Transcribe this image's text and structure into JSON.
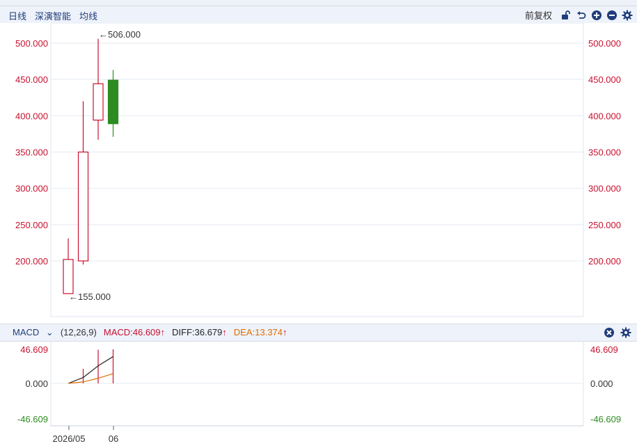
{
  "toolbar": {
    "tabs": [
      "日线",
      "深演智能",
      "均线"
    ],
    "adjust_label": "前复权"
  },
  "price_axis": {
    "ticks": [
      "500.000",
      "450.000",
      "400.000",
      "350.000",
      "300.000",
      "250.000",
      "200.000"
    ],
    "tick_values": [
      500,
      450,
      400,
      350,
      300,
      250,
      200
    ],
    "color": "#c8102e"
  },
  "annotations": {
    "high": "←506.000",
    "low": "←155.000"
  },
  "macd": {
    "name": "MACD",
    "params": "(12,26,9)",
    "macd_label": "MACD:46.609",
    "diff_label": "DIFF:36.679",
    "dea_label": "DEA:13.374",
    "axis_top": "46.609",
    "axis_mid": "0.000",
    "axis_bottom": "-46.609",
    "colors": {
      "macd": "#c8102e",
      "diff": "#222222",
      "dea": "#e06c00"
    }
  },
  "x_axis": {
    "labels": [
      "2026/05",
      "06"
    ]
  },
  "chart_data": {
    "type": "candlestick",
    "ylim": [
      130,
      520
    ],
    "candles": [
      {
        "open": 155,
        "high": 231,
        "low": 155,
        "close": 202,
        "up": true
      },
      {
        "open": 200,
        "high": 420,
        "low": 195,
        "close": 350,
        "up": true
      },
      {
        "open": 394,
        "high": 506,
        "low": 367,
        "close": 444,
        "up": true
      },
      {
        "open": 449,
        "high": 463,
        "low": 371,
        "close": 389,
        "up": false
      }
    ],
    "macd_series": {
      "ylim": [
        -46.609,
        46.609
      ],
      "diff": [
        0,
        8,
        24,
        36.679
      ],
      "dea": [
        0,
        2,
        7,
        13.374
      ],
      "hist": [
        0,
        20,
        46,
        46.609
      ]
    },
    "colors": {
      "up": "#c8102e",
      "down": "#2e8b22"
    }
  }
}
